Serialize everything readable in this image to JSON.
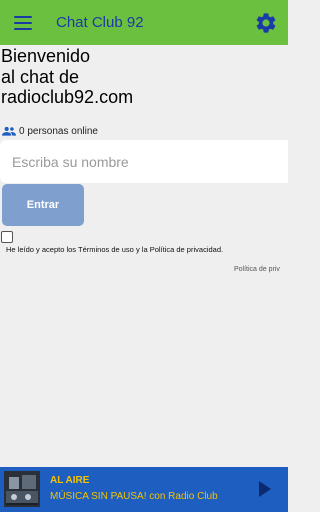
{
  "appbar": {
    "title": "Chat Club 92",
    "menu_icon": "hamburger-menu-icon",
    "settings_icon": "gear-icon"
  },
  "welcome": {
    "line1": "Bienvenido",
    "line2": "al chat de",
    "line3": "radioclub92.com"
  },
  "online": {
    "icon": "people-icon",
    "text": "0 personas online"
  },
  "form": {
    "name_placeholder": "Escriba su nombre",
    "name_value": "",
    "enter_label": "Entrar",
    "terms_checked": false,
    "terms_prefix": "He leído y acepto los ",
    "terms_link": "Términos de uso",
    "terms_middle": " y la ",
    "privacy_link": "Política de privacidad",
    "terms_suffix": "."
  },
  "privacy_footer_link": "Política de priv",
  "player": {
    "status": "AL AIRE",
    "track": "MÚSICA SIN PAUSA! con Radio Club",
    "play_icon": "play-icon"
  },
  "colors": {
    "appbar": "#6cc040",
    "accent_blue": "#1a3aa8",
    "player_bar": "#1e5ec0",
    "player_text": "#f5c400",
    "button": "#7fa0cf"
  }
}
